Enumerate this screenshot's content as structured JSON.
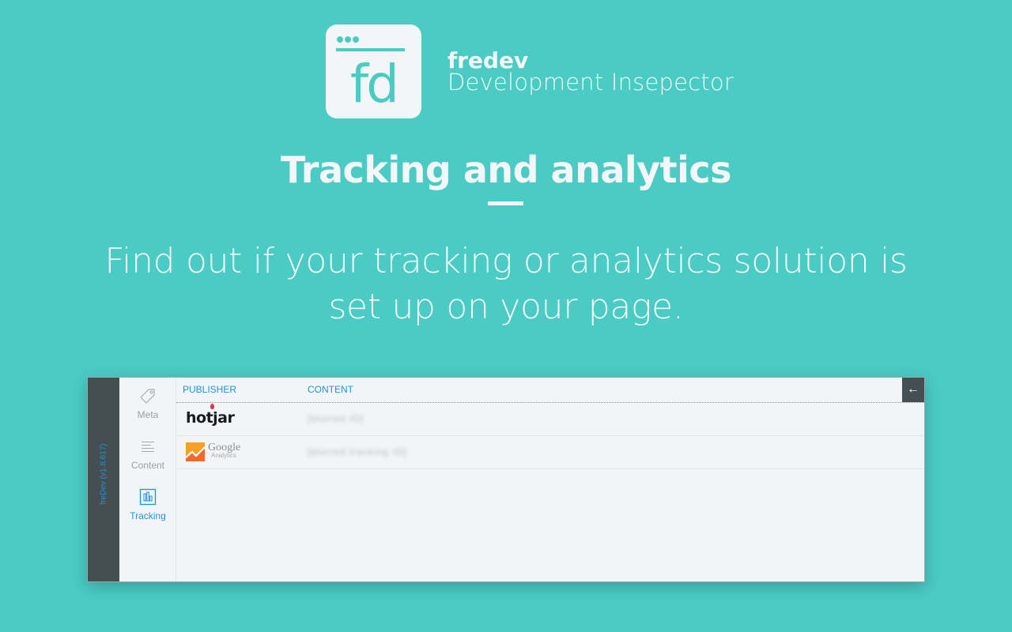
{
  "brand": {
    "logo_letters": "fd",
    "name": "fredev",
    "subtitle": "Development Insepector"
  },
  "hero": {
    "headline": "Tracking and analytics",
    "subline": "Find out if your tracking or analytics solution is set up on your page."
  },
  "colors": {
    "background": "#4acbc4",
    "accent": "#1e95d4",
    "sidebar_dark": "#454e53",
    "panel_bg": "#f2f5f8"
  },
  "panel": {
    "version_label": "freDev (v1.8.617)",
    "nav": [
      {
        "label": "Meta",
        "icon": "tag-icon",
        "active": false
      },
      {
        "label": "Content",
        "icon": "text-lines-icon",
        "active": false
      },
      {
        "label": "Tracking",
        "icon": "bar-chart-icon",
        "active": true
      }
    ],
    "table": {
      "columns": [
        "PUBLISHER",
        "CONTENT"
      ],
      "rows": [
        {
          "publisher": "hotjar",
          "content": "[blurred ID]"
        },
        {
          "publisher": "Google Analytics",
          "publisher_line1": "Google",
          "publisher_line2": "Analytics",
          "content": "[blurred tracking ID]"
        }
      ]
    },
    "back_button": "←"
  }
}
